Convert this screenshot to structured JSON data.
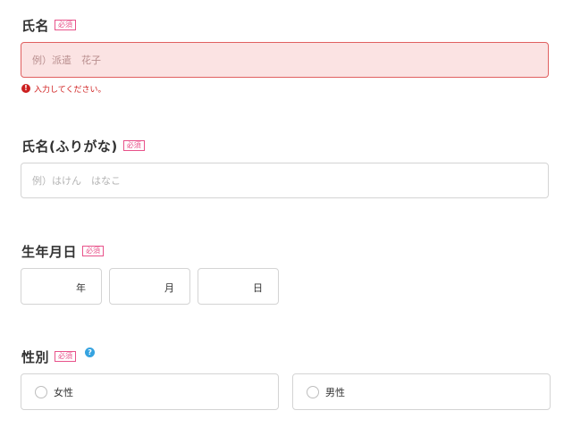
{
  "name": {
    "label": "氏名",
    "required": "必須",
    "placeholder": "例）派遣　花子",
    "value": "",
    "error_icon": "exclamation-icon",
    "error": "入力してください。"
  },
  "kana": {
    "label": "氏名(ふりがな)",
    "required": "必須",
    "placeholder": "例）はけん　はなこ",
    "value": ""
  },
  "birthdate": {
    "label": "生年月日",
    "required": "必須",
    "year_unit": "年",
    "month_unit": "月",
    "day_unit": "日"
  },
  "gender": {
    "label": "性別",
    "required": "必須",
    "help_icon": "question-icon",
    "help_glyph": "?",
    "options": [
      {
        "label": "女性",
        "selected": false
      },
      {
        "label": "男性",
        "selected": false
      }
    ]
  },
  "colors": {
    "required_accent": "#e8528a",
    "error_red": "#d02020",
    "error_bg": "#fbe3e3",
    "help_blue": "#36a3e0",
    "border": "#d4d4d4"
  }
}
